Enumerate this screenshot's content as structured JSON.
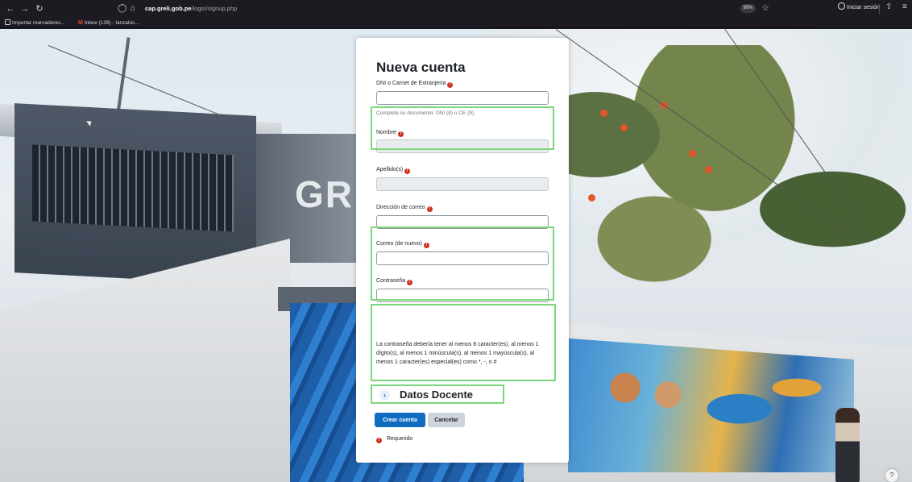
{
  "browser": {
    "url_host": "cap.greli.gob.pe",
    "url_path": "/login/signup.php",
    "zoom": "90%",
    "signin_label": "Iniciar sesión",
    "bookmarks": [
      {
        "label": "Importar marcadores..."
      },
      {
        "label": "Inbox (139) - lanzaloc..."
      }
    ]
  },
  "background": {
    "sign_letters": "GR"
  },
  "form": {
    "title": "Nueva cuenta",
    "dni": {
      "label": "DNI o Carnet de Extranjería",
      "value": "",
      "help": "Complete su documento: DNI (8) o CE (9)."
    },
    "nombre": {
      "label": "Nombre",
      "value": ""
    },
    "apellidos": {
      "label": "Apellido(s)",
      "value": ""
    },
    "email": {
      "label": "Dirección de correo",
      "value": ""
    },
    "email2": {
      "label": "Correo (de nuevo)",
      "value": ""
    },
    "password": {
      "label": "Contraseña",
      "value": "",
      "hint": "La contraseña debería tener al menos 8 caracter(es), al menos 1 dígito(s), al menos 1 minúscula(s), al menos 1 mayúscula(s), al menos 1 caracter(es) especial(es) como *, -, o #"
    },
    "section_title": "Datos Docente",
    "submit_label": "Crear cuenta",
    "cancel_label": "Cancelar",
    "required_legend": "Requerido"
  },
  "colors": {
    "primary": "#0f6cbf",
    "required": "#ca3120",
    "highlight": "#7ad87a"
  }
}
